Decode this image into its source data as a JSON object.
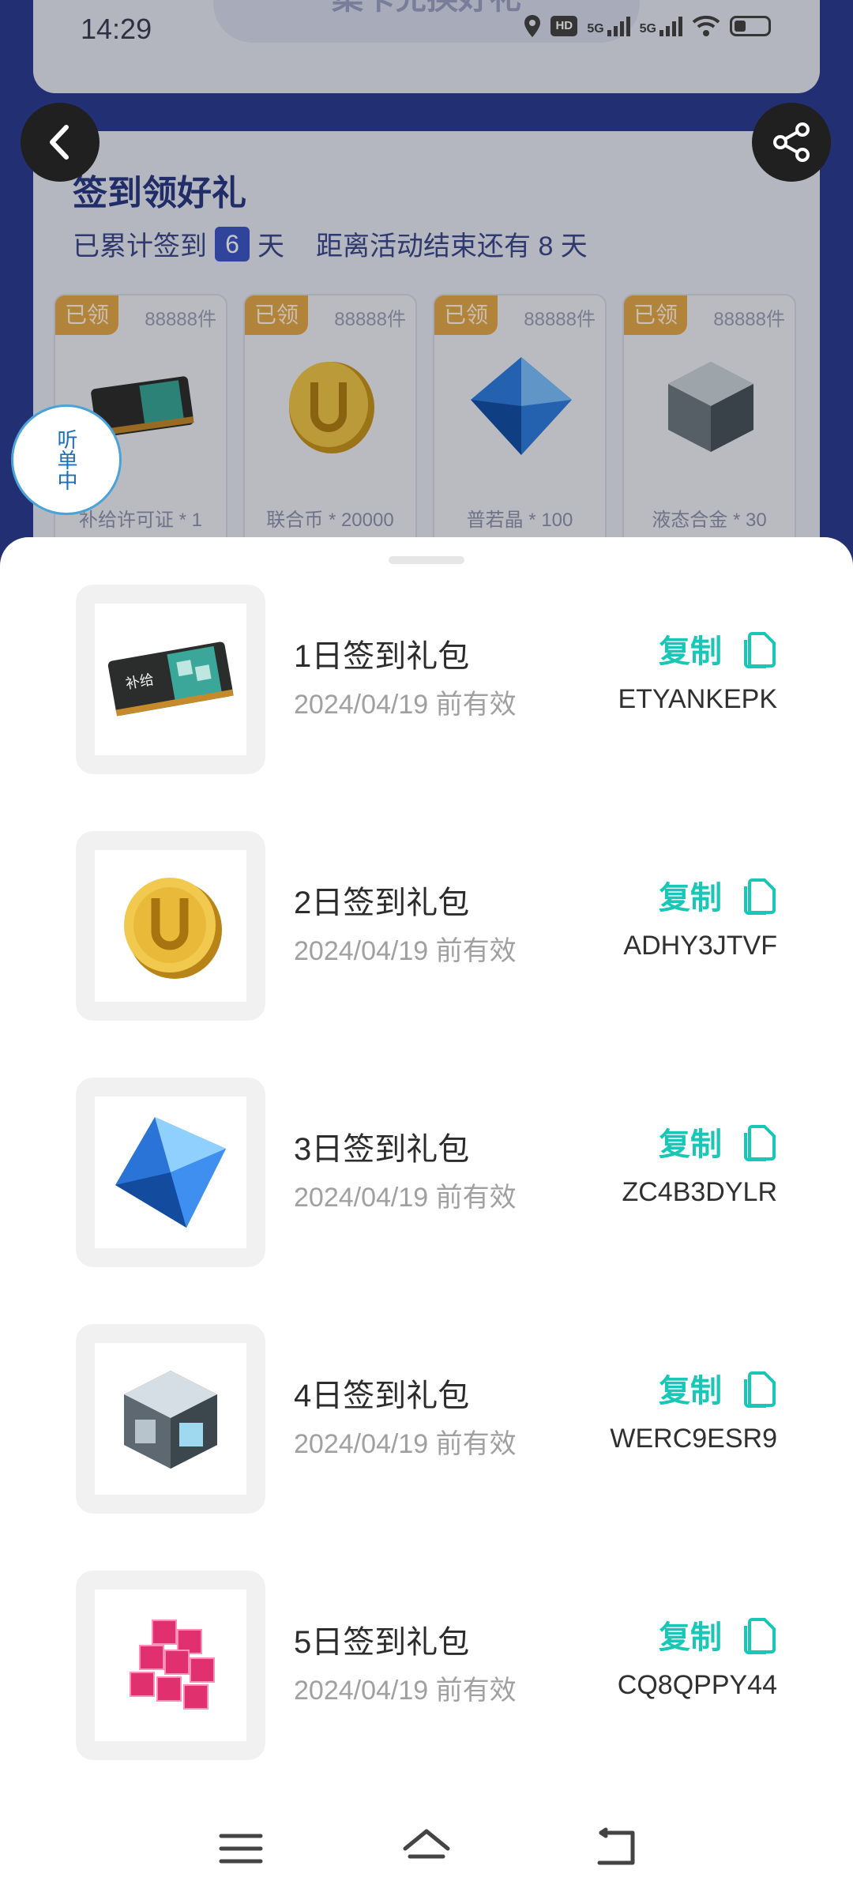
{
  "status_bar": {
    "time": "14:29",
    "hd": "HD",
    "net1": "5G",
    "net2": "5G"
  },
  "header_banner": {
    "text": "集卡兑换好礼"
  },
  "sign_in": {
    "title": "签到领好礼",
    "prefix": "已累计签到",
    "days": "6",
    "days_unit": "天",
    "remaining": "距离活动结束还有 8 天",
    "rewards": [
      {
        "tag": "已领",
        "count": "88888件",
        "name": "补给许可证 * 1",
        "icon": "ticket-icon"
      },
      {
        "tag": "已领",
        "count": "88888件",
        "name": "联合币 * 20000",
        "icon": "gold-coin-icon"
      },
      {
        "tag": "已领",
        "count": "88888件",
        "name": "普若晶 * 100",
        "icon": "blue-crystal-icon"
      },
      {
        "tag": "已领",
        "count": "88888件",
        "name": "液态合金 * 30",
        "icon": "metal-cube-icon"
      }
    ]
  },
  "listen_bubble": {
    "label": "听单中"
  },
  "gifts": [
    {
      "name": "1日签到礼包",
      "date": "2024/04/19 前有效",
      "copy_label": "复制",
      "code": "ETYANKEPK",
      "icon": "ticket-icon"
    },
    {
      "name": "2日签到礼包",
      "date": "2024/04/19 前有效",
      "copy_label": "复制",
      "code": "ADHY3JTVF",
      "icon": "gold-coin-icon"
    },
    {
      "name": "3日签到礼包",
      "date": "2024/04/19 前有效",
      "copy_label": "复制",
      "code": "ZC4B3DYLR",
      "icon": "blue-crystal-icon"
    },
    {
      "name": "4日签到礼包",
      "date": "2024/04/19 前有效",
      "copy_label": "复制",
      "code": "WERC9ESR9",
      "icon": "metal-cube-icon"
    },
    {
      "name": "5日签到礼包",
      "date": "2024/04/19 前有效",
      "copy_label": "复制",
      "code": "CQ8QPPY44",
      "icon": "pink-cubes-icon"
    }
  ],
  "colors": {
    "accent": "#19c7b6",
    "claimed": "#e4a84c",
    "page_bg": "#2d3d94"
  },
  "nav": {
    "icons": [
      "menu-icon",
      "home-icon",
      "back-icon"
    ]
  }
}
